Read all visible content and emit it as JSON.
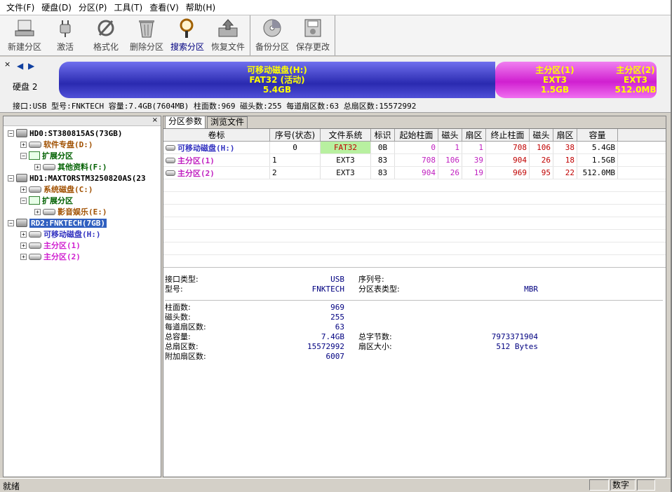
{
  "menubar": [
    "文件(F)",
    "硬盘(D)",
    "分区(P)",
    "工具(T)",
    "查看(V)",
    "帮助(H)"
  ],
  "toolbar": {
    "group1": [
      {
        "label": "新建分区",
        "icon": "new-partition-icon"
      },
      {
        "label": "激活",
        "icon": "plug-icon"
      },
      {
        "label": "格式化",
        "icon": "format-icon"
      },
      {
        "label": "删除分区",
        "icon": "trash-icon"
      },
      {
        "label": "搜索分区",
        "icon": "search-icon"
      },
      {
        "label": "恢复文件",
        "icon": "recover-icon"
      }
    ],
    "group2": [
      {
        "label": "备份分区",
        "icon": "backup-disc-icon"
      },
      {
        "label": "保存更改",
        "icon": "save-icon"
      }
    ]
  },
  "disk": {
    "label": "硬盘 2",
    "segments": [
      {
        "line1": "可移动磁盘(H:)",
        "line2": "FAT32 (活动)",
        "line3": "5.4GB"
      },
      {
        "line1": "主分区(1)",
        "line2": "EXT3",
        "line3": "1.5GB"
      },
      {
        "line1": "主分区(2)",
        "line2": "EXT3",
        "line3": "512.0MB"
      }
    ],
    "info": "接口:USB  型号:FNKTECH  容量:7.4GB(7604MB)  柱面数:969  磁头数:255  每道扇区数:63  总扇区数:15572992"
  },
  "tree": {
    "hd0": "HD0:ST380815AS(73GB)",
    "hd0_p1": "软件专盘(D:)",
    "hd0_ext": "扩展分区",
    "hd0_p2": "其他资料(F:)",
    "hd1": "HD1:MAXTORSTM3250820AS(23",
    "hd1_p1": "系统磁盘(C:)",
    "hd1_ext": "扩展分区",
    "hd1_p2": "影音娱乐(E:)",
    "rd2": "RD2:FNKTECH(7GB)",
    "rd2_p1": "可移动磁盘(H:)",
    "rd2_p2": "主分区(1)",
    "rd2_p3": "主分区(2)"
  },
  "tabs": [
    "分区参数",
    "浏览文件"
  ],
  "table": {
    "headers": [
      "卷标",
      "序号(状态)",
      "文件系统",
      "标识",
      "起始柱面",
      "磁头",
      "扇区",
      "终止柱面",
      "磁头",
      "扇区",
      "容量"
    ],
    "rows": [
      [
        "可移动磁盘(H:)",
        "0",
        "FAT32",
        "0B",
        "0",
        "1",
        "1",
        "708",
        "106",
        "38",
        "5.4GB"
      ],
      [
        "主分区(1)",
        "1",
        "EXT3",
        "83",
        "708",
        "106",
        "39",
        "904",
        "26",
        "18",
        "1.5GB"
      ],
      [
        "主分区(2)",
        "2",
        "EXT3",
        "83",
        "904",
        "26",
        "19",
        "969",
        "95",
        "22",
        "512.0MB"
      ]
    ]
  },
  "details": {
    "iface_label": "接口类型:",
    "iface_val": "USB",
    "serial_label": "序列号:",
    "model_label": "型号:",
    "model_val": "FNKTECH",
    "ptype_label": "分区表类型:",
    "ptype_val": "MBR",
    "cyl_label": "柱面数:",
    "cyl_val": "969",
    "heads_label": "磁头数:",
    "heads_val": "255",
    "spt_label": "每道扇区数:",
    "spt_val": "63",
    "cap_label": "总容量:",
    "cap_val": "7.4GB",
    "bytes_label": "总字节数:",
    "bytes_val": "7973371904",
    "sect_label": "总扇区数:",
    "sect_val": "15572992",
    "ssize_label": "扇区大小:",
    "ssize_val": "512 Bytes",
    "extra_label": "附加扇区数:",
    "extra_val": "6007"
  },
  "status": {
    "left": "就绪",
    "numlock": "数字"
  }
}
